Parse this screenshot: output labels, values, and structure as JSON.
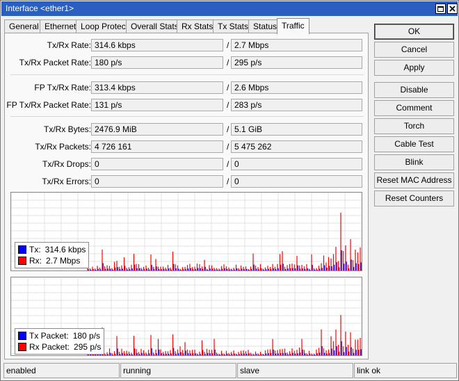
{
  "window": {
    "title": "Interface <ether1>"
  },
  "tabs": [
    {
      "label": "General"
    },
    {
      "label": "Ethernet"
    },
    {
      "label": "Loop Protect"
    },
    {
      "label": "Overall Stats"
    },
    {
      "label": "Rx Stats"
    },
    {
      "label": "Tx Stats"
    },
    {
      "label": "Status"
    },
    {
      "label": "Traffic",
      "active": true
    }
  ],
  "stats": {
    "tx_rx_rate": {
      "label": "Tx/Rx Rate:",
      "tx": "314.6 kbps",
      "rx": "2.7 Mbps"
    },
    "tx_rx_packet_rate": {
      "label": "Tx/Rx Packet Rate:",
      "tx": "180 p/s",
      "rx": "295 p/s"
    },
    "fp_tx_rx_rate": {
      "label": "FP Tx/Rx Rate:",
      "tx": "313.4 kbps",
      "rx": "2.6 Mbps"
    },
    "fp_tx_rx_packet_rate": {
      "label": "FP Tx/Rx Packet Rate:",
      "tx": "131 p/s",
      "rx": "283 p/s"
    },
    "tx_rx_bytes": {
      "label": "Tx/Rx Bytes:",
      "tx": "2476.9 MiB",
      "rx": "5.1 GiB"
    },
    "tx_rx_packets": {
      "label": "Tx/Rx Packets:",
      "tx": "4 726 161",
      "rx": "5 475 262"
    },
    "tx_rx_drops": {
      "label": "Tx/Rx Drops:",
      "tx": "0",
      "rx": "0"
    },
    "tx_rx_errors": {
      "label": "Tx/Rx Errors:",
      "tx": "0",
      "rx": "0"
    },
    "separator": "/"
  },
  "graphs": {
    "colors": {
      "tx": "#0000ff",
      "rx": "#ff0000",
      "grid": "#e0e0e0"
    },
    "traffic": {
      "tx_label": "Tx:",
      "tx_value": "314.6 kbps",
      "rx_label": "Rx:",
      "rx_value": "2.7 Mbps"
    },
    "packets": {
      "tx_label": "Tx Packet:",
      "tx_value": "180 p/s",
      "rx_label": "Rx Packet:",
      "rx_value": "295 p/s"
    }
  },
  "buttons": {
    "ok": "OK",
    "cancel": "Cancel",
    "apply": "Apply",
    "disable": "Disable",
    "comment": "Comment",
    "torch": "Torch",
    "cable_test": "Cable Test",
    "blink": "Blink",
    "reset_mac": "Reset MAC Address",
    "reset_counters": "Reset Counters"
  },
  "status_bar": [
    "enabled",
    "running",
    "slave",
    "link ok"
  ]
}
